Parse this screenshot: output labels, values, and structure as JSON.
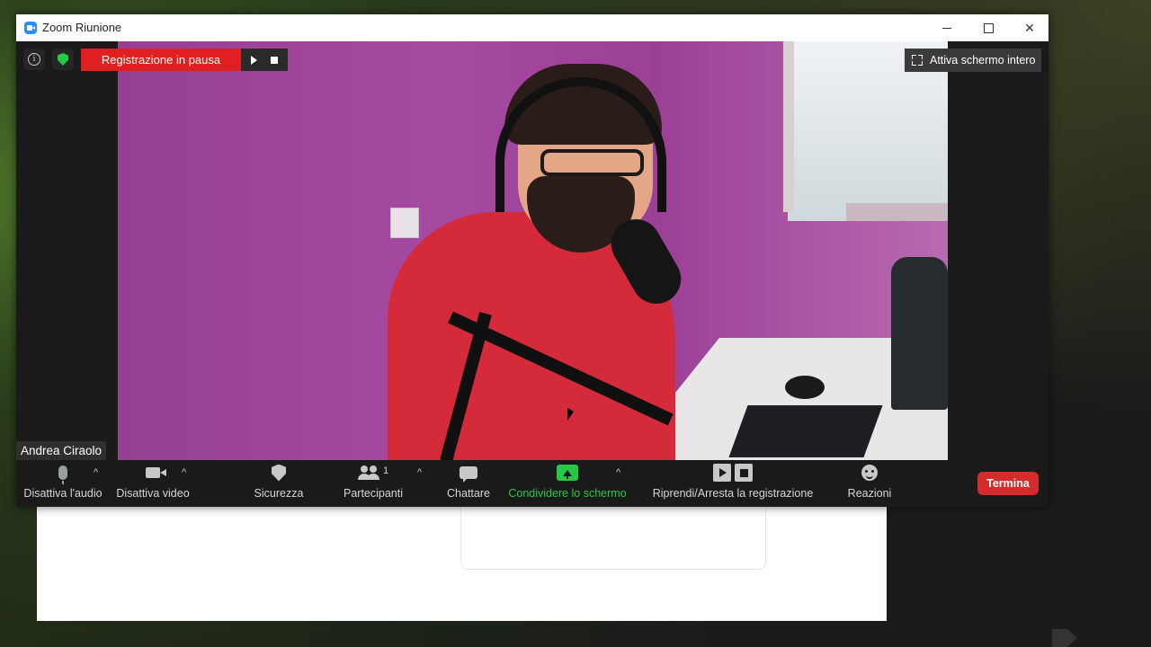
{
  "window": {
    "title": "Zoom Riunione"
  },
  "video": {
    "recording_status": "Registrazione in pausa",
    "fullscreen_label": "Attiva schermo intero",
    "participant_name": "Andrea Ciraolo"
  },
  "toolbar": {
    "audio_label": "Disattiva l'audio",
    "video_label": "Disattiva video",
    "security_label": "Sicurezza",
    "participants_label": "Partecipanti",
    "participants_count": "1",
    "chat_label": "Chattare",
    "share_label": "Condividere lo schermo",
    "recording_label": "Riprendi/Arresta la registrazione",
    "reactions_label": "Reazioni",
    "end_label": "Termina"
  },
  "colors": {
    "accent_green": "#26c947",
    "recording_red": "#e02020",
    "end_red": "#d52b2b"
  }
}
